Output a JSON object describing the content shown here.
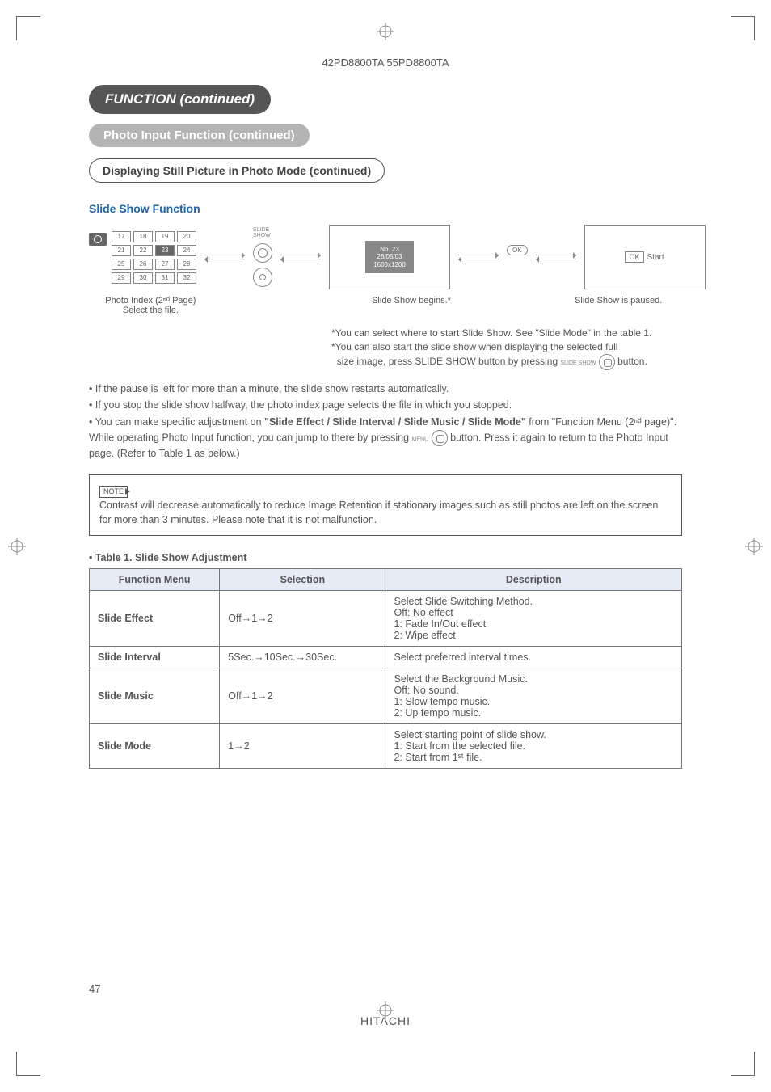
{
  "header": {
    "model": "42PD8800TA 55PD8800TA"
  },
  "titles": {
    "function": "FUNCTION (continued)",
    "photo": "Photo Input Function (continued)",
    "displaying": "Displaying Still Picture in Photo Mode (continued)",
    "slide": "Slide Show Function"
  },
  "flow": {
    "thumbs": [
      "17",
      "18",
      "19",
      "20",
      "21",
      "22",
      "23",
      "24",
      "25",
      "26",
      "27",
      "28",
      "29",
      "30",
      "31",
      "32"
    ],
    "photoIndexLine1": "Photo Index (2ⁿᵈ Page)",
    "photoIndexLine2": "Select the file.",
    "slideShowLabel": "SLIDE SHOW",
    "okLabel": "OK",
    "infoNo": "No. 23",
    "infoDate": "28/05/03",
    "infoRes": "1600x1200",
    "beginsCaption": "Slide Show begins.*",
    "startBtn": "OK",
    "startTxt": "Start",
    "pausedCaption": "Slide Show is paused."
  },
  "sideNotes": {
    "n1": "*You can select where to start Slide Show. See \"Slide Mode\" in the table 1.",
    "n2": "*You can also start the slide show when displaying the selected full",
    "n3": "size image, press SLIDE SHOW button by pressing",
    "n3b": "button."
  },
  "bullets": {
    "b1": "• If the pause is left for more than a minute, the slide show restarts automatically.",
    "b2": "• If you stop the slide show halfway, the photo index page selects the file in which you stopped.",
    "b3a": "• You can make specific adjustment on ",
    "b3bold": "\"Slide Effect / Slide Interval / Slide Music / Slide Mode\"",
    "b3b": " from \"Function Menu (2ⁿᵈ page)\". While operating Photo Input function, you can jump to there by pressing ",
    "b3menu": "MENU",
    "b3c": " button.  Press it again to return to the Photo Input page. (Refer to Table 1 as below.)"
  },
  "note": {
    "tag": "NOTE",
    "text": "Contrast will decrease automatically to reduce Image Retention if stationary images such as still photos are left on the screen for more than 3 minutes. Please note that it is not malfunction."
  },
  "table": {
    "title": "• Table 1. Slide Show Adjustment",
    "headers": [
      "Function Menu",
      "Selection",
      "Description"
    ],
    "rows": [
      {
        "fn": "Slide Effect",
        "sel": "Off→1→2",
        "desc": "Select Slide Switching Method.\nOff: No effect\n1: Fade In/Out effect\n2: Wipe effect"
      },
      {
        "fn": "Slide Interval",
        "sel": "5Sec.→10Sec.→30Sec.",
        "desc": "Select preferred interval times."
      },
      {
        "fn": "Slide Music",
        "sel": "Off→1→2",
        "desc": "Select the Background Music.\nOff: No sound.\n1: Slow tempo music.\n2: Up tempo music."
      },
      {
        "fn": "Slide Mode",
        "sel": "1→2",
        "desc": "Select starting point of slide show.\n1: Start from the selected file.\n2: Start from 1ˢᵗ file."
      }
    ]
  },
  "footer": {
    "page": "47",
    "brand": "HITACHI"
  }
}
